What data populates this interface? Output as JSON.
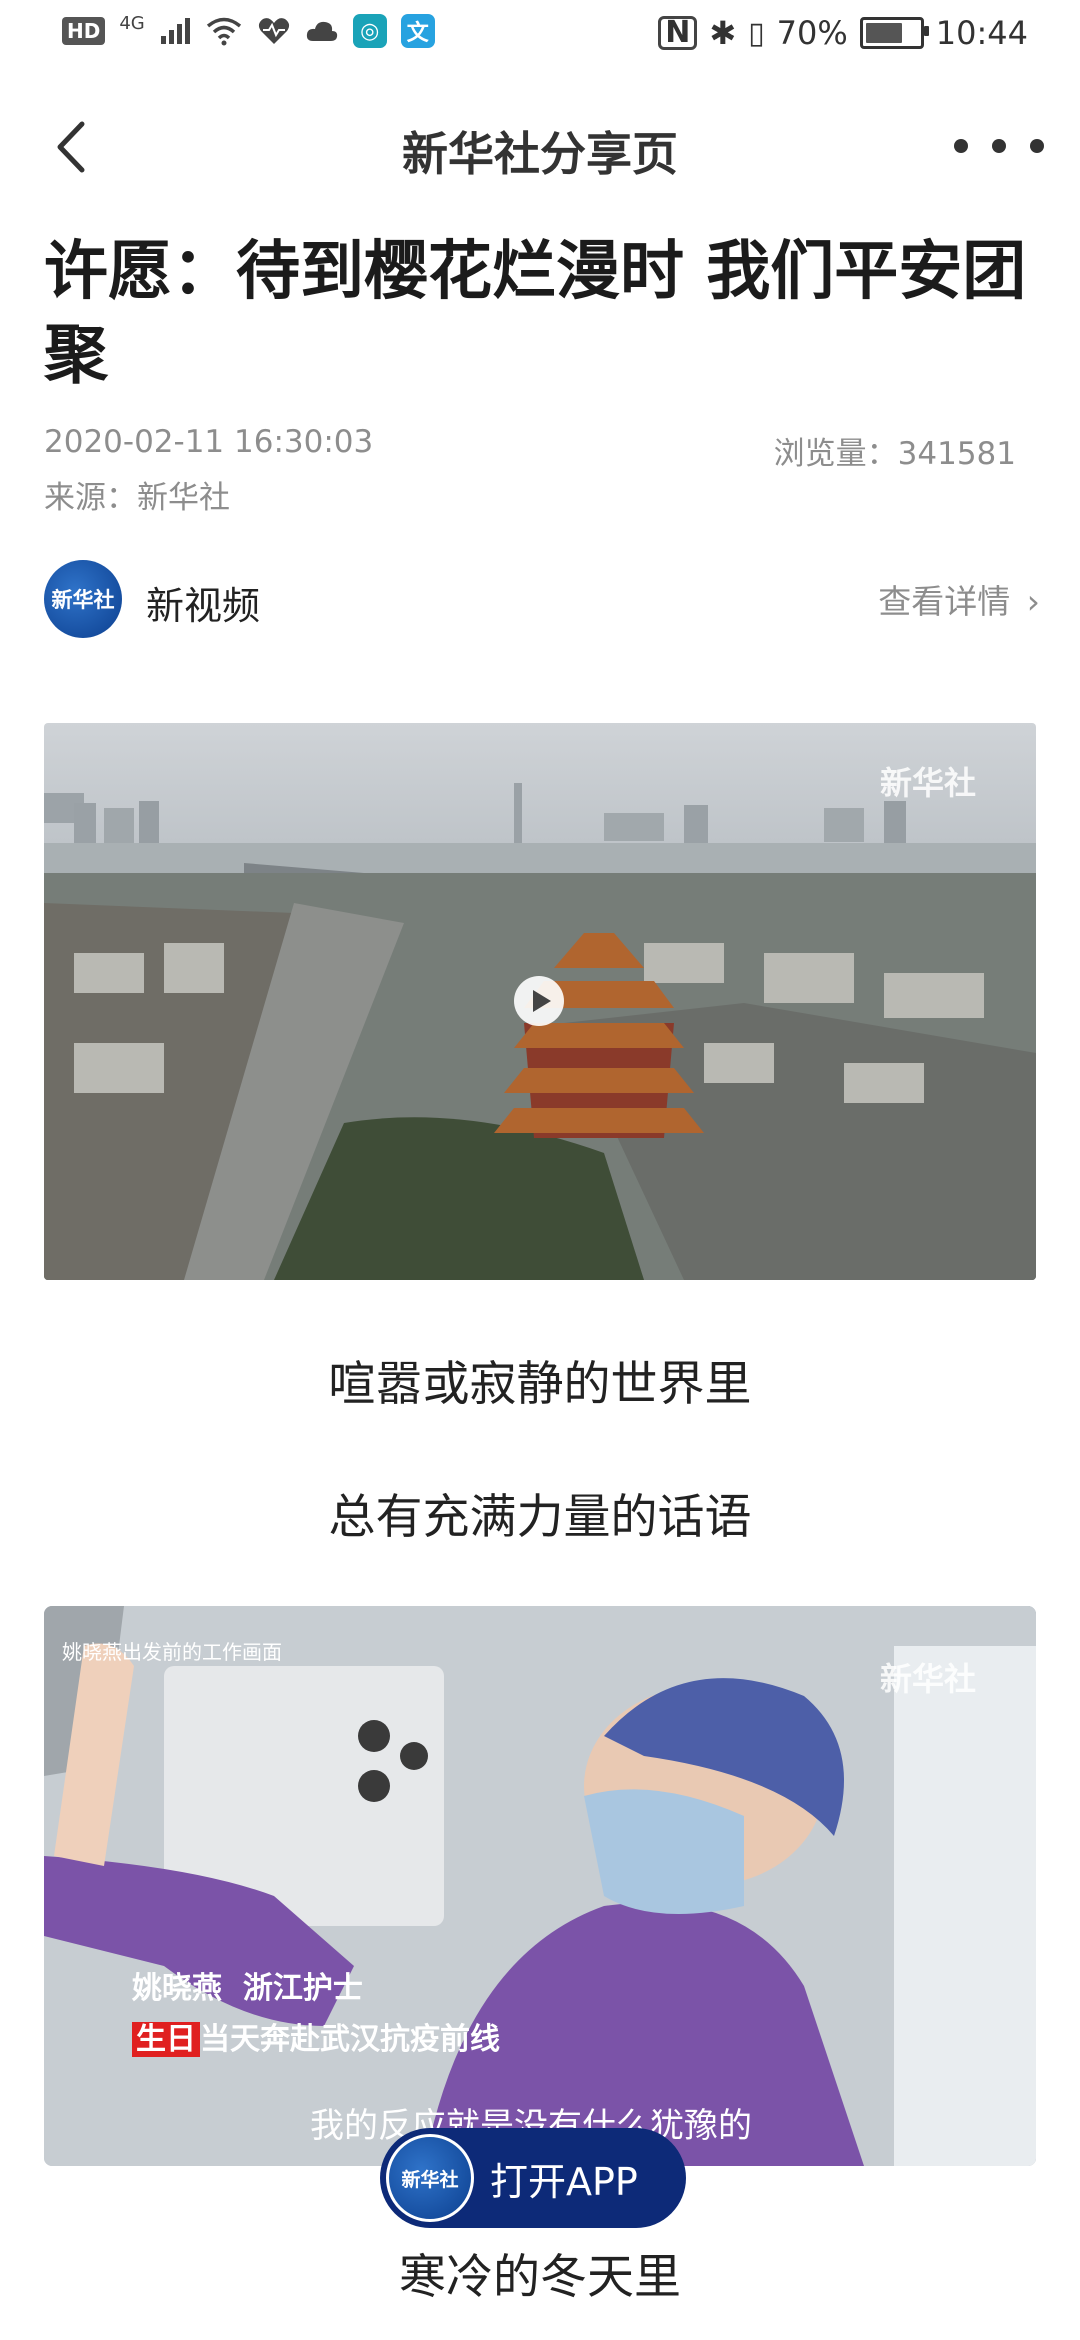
{
  "status_bar": {
    "hd": "HD",
    "network": "4G",
    "battery_pct": "70%",
    "battery_level": 0.7,
    "time": "10:44"
  },
  "nav": {
    "title": "新华社分享页"
  },
  "article": {
    "headline": "许愿：待到樱花烂漫时 我们平安团聚",
    "date": "2020-02-11 16:30:03",
    "views": "浏览量：341581",
    "source": "来源：新华社"
  },
  "channel": {
    "name": "新视频",
    "details": "查看详情",
    "logo_text": "新华社"
  },
  "media": {
    "video_watermark": "新华社",
    "photo_watermark": "新华社",
    "photo_top_caption": "姚晓燕出发前的工作画面",
    "photo_name_caption": "姚晓燕  浙江护士",
    "photo_birthday": "生日",
    "photo_birthday_line": "当天奔赴武汉抗疫前线",
    "photo_subtitle": "我的反应就是没有什么犹豫的"
  },
  "body": {
    "line1": "喧嚣或寂静的世界里",
    "line2": "总有充满力量的话语",
    "line3": "寒冷的冬天里"
  },
  "app_button": {
    "label": "打开APP",
    "logo_text": "新华社"
  },
  "icons": [
    "signal-icon",
    "wifi-icon",
    "health-icon",
    "cloud-icon",
    "nfc-icon",
    "bluetooth-icon",
    "vibrate-icon",
    "battery-icon",
    "back-arrow-icon",
    "more-icon",
    "chevron-right-icon",
    "play-icon"
  ]
}
